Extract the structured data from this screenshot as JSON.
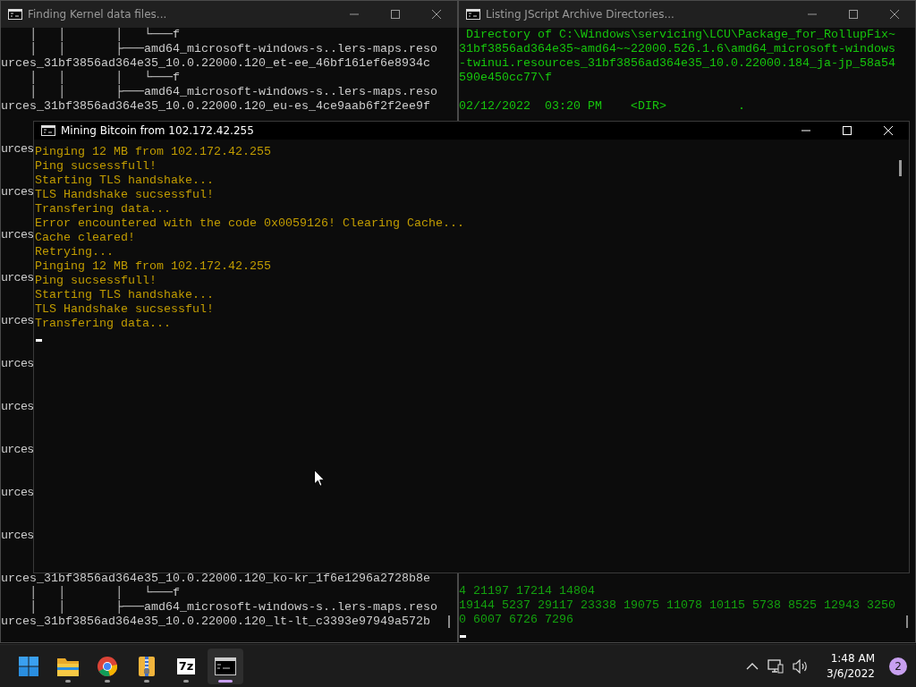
{
  "windows": [
    {
      "kind": "tree",
      "title": "Finding Kernel data files...",
      "active": false,
      "top_lines": [
        "    │   │       │   └───f",
        "    │   │       ├───amd64_microsoft-windows-s..lers-maps.reso",
        "urces_31bf3856ad364e35_10.0.22000.120_et-ee_46bf161ef6e8934c",
        "    │   │       │   └───f",
        "    │   │       ├───amd64_microsoft-windows-s..lers-maps.reso",
        "urces_31bf3856ad364e35_10.0.22000.120_eu-es_4ce9aab6f2f2ee9f"
      ],
      "edge_fragments": [
        "urces",
        "urces",
        "urces",
        "urces",
        "urces",
        "urces",
        "urces",
        "urces",
        "urces",
        "urces"
      ],
      "bottom_lines": [
        "urces_31bf3856ad364e35_10.0.22000.120_ko-kr_1f6e1296a2728b8e",
        "    │   │       │   └───f",
        "    │   │       ├───amd64_microsoft-windows-s..lers-maps.reso",
        "urces_31bf3856ad364e35_10.0.22000.120_lt-lt_c3393e97949a572b"
      ]
    },
    {
      "kind": "listing",
      "title": "Listing JScript Archive Directories...",
      "active": false,
      "path_lines": [
        " Directory of C:\\Windows\\servicing\\LCU\\Package_for_RollupFix~",
        "31bf3856ad364e35~amd64~~22000.526.1.6\\amd64_microsoft-windows",
        "-twinui.resources_31bf3856ad364e35_10.0.22000.184_ja-jp_58a54",
        "590e450cc77\\f"
      ],
      "entry_lines": [
        "02/12/2022  03:20 PM    <DIR>          ."
      ],
      "bottom_lines": [
        "4 21197 17214 14804",
        "19144 5237 29117 23338 19075 11078 10115 5738 8525 12943 3250",
        "0 6007 6726 7296"
      ]
    },
    {
      "kind": "log",
      "title": "Mining Bitcoin from 102.172.42.255",
      "active": true,
      "lines": [
        "Pinging 12 MB from 102.172.42.255",
        "Ping sucsessfull!",
        "Starting TLS handshake...",
        "TLS Handshake sucsessful!",
        "Transfering data...",
        "Error encountered with the code 0x0059126! Clearing Cache...",
        "Cache cleared!",
        "Retrying...",
        "Pinging 12 MB from 102.172.42.255",
        "Ping sucsessfull!",
        "Starting TLS handshake...",
        "TLS Handshake sucsessful!",
        "Transfering data..."
      ]
    }
  ],
  "taskbar": {
    "apps": [
      {
        "kind": "start",
        "selected": false
      },
      {
        "kind": "folder",
        "running": true,
        "selected": false
      },
      {
        "kind": "browser",
        "running": true,
        "selected": false
      },
      {
        "kind": "archive",
        "running": true,
        "selected": false
      },
      {
        "kind": "sevenzip",
        "label": "7z",
        "running": true,
        "selected": false
      },
      {
        "kind": "terminal",
        "running": true,
        "selected": true
      }
    ],
    "tray": {
      "time": "1:48 AM",
      "date": "3/6/2022",
      "notifications": "2"
    }
  }
}
